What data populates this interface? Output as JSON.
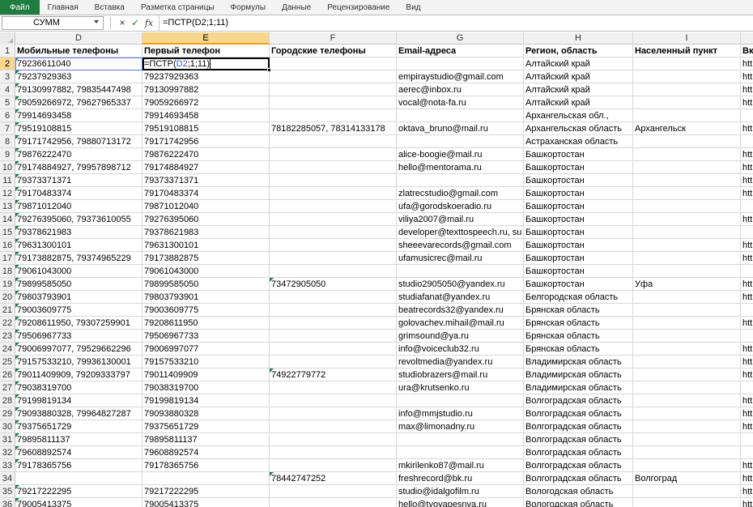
{
  "ribbon": {
    "tabs": [
      "Файл",
      "Главная",
      "Вставка",
      "Разметка страницы",
      "Формулы",
      "Данные",
      "Рецензирование",
      "Вид"
    ]
  },
  "formula_bar": {
    "name_box": "СУММ",
    "cancel_icon": "×",
    "enter_icon": "✓",
    "fx_label": "fx",
    "formula": "=ПСТР(D2;1;11)"
  },
  "columns": [
    "D",
    "E",
    "F",
    "G",
    "H",
    "I"
  ],
  "column_cut": "",
  "active_cell": {
    "row": 2,
    "column": "E",
    "prefix": "=ПСТР(",
    "ref": "D2",
    "suffix": ";1;11)"
  },
  "colors": {
    "accent": "#1f7d3f",
    "active_header": "#f9d68f",
    "reference_blue": "#3a5fcd"
  },
  "rows": [
    {
      "n": "1",
      "D": "Мобильные телефоны",
      "E": "Первый телефон",
      "F": "Городские телефоны",
      "G": "Email-адреса",
      "H": "Регион, область",
      "I": "Населенный пункт",
      "J": "Вк",
      "bold": true
    },
    {
      "n": "2",
      "D": "79236611040",
      "E": "",
      "F": "",
      "G": "",
      "H": "Алтайский край",
      "I": "",
      "J": "htt",
      "triD": true
    },
    {
      "n": "3",
      "D": "79237929363",
      "E": "79237929363",
      "F": "",
      "G": "empiraystudio@gmail.com",
      "H": "Алтайский край",
      "I": "",
      "J": "htt",
      "triD": true
    },
    {
      "n": "4",
      "D": "79130997882, 79835447498",
      "E": "79130997882",
      "F": "",
      "G": "aerec@inbox.ru",
      "H": "Алтайский край",
      "I": "",
      "J": "htt",
      "triD": true
    },
    {
      "n": "5",
      "D": "79059266972, 79627965337",
      "E": "79059266972",
      "F": "",
      "G": "vocal@nota-fa.ru",
      "H": "Алтайский край",
      "I": "",
      "J": "htt",
      "triD": true
    },
    {
      "n": "6",
      "D": "79914693458",
      "E": "79914693458",
      "F": "",
      "G": "",
      "H": "Архангельская обл.,",
      "I": "",
      "J": "",
      "triD": true
    },
    {
      "n": "7",
      "D": "79519108815",
      "E": "79519108815",
      "F": "78182285057, 78314133178",
      "G": "oktava_bruno@mail.ru",
      "H": "Архангельская область",
      "I": "Архангельск",
      "J": "htt",
      "triD": true
    },
    {
      "n": "8",
      "D": "79171742956, 79880713172",
      "E": "79171742956",
      "F": "",
      "G": "",
      "H": "Астраханская область",
      "I": "",
      "J": "",
      "triD": true
    },
    {
      "n": "9",
      "D": "79876222470",
      "E": "79876222470",
      "F": "",
      "G": "alice-boogie@mail.ru",
      "H": "Башкортостан",
      "I": "",
      "J": "htt",
      "triD": true
    },
    {
      "n": "10",
      "D": "79174884927, 79957898712",
      "E": "79174884927",
      "F": "",
      "G": "hello@mentorama.ru",
      "H": "Башкортостан",
      "I": "",
      "J": "htt",
      "triD": true
    },
    {
      "n": "11",
      "D": "79373371371",
      "E": "79373371371",
      "F": "",
      "G": "",
      "H": "Башкортостан",
      "I": "",
      "J": "htt",
      "triD": true
    },
    {
      "n": "12",
      "D": "79170483374",
      "E": "79170483374",
      "F": "",
      "G": "zlatrecstudio@gmail.com",
      "H": "Башкортостан",
      "I": "",
      "J": "htt",
      "triD": true
    },
    {
      "n": "13",
      "D": "79871012040",
      "E": "79871012040",
      "F": "",
      "G": "ufa@gorodskoeradio.ru",
      "H": "Башкортостан",
      "I": "",
      "J": "",
      "triD": true
    },
    {
      "n": "14",
      "D": "79276395060, 79373610055",
      "E": "79276395060",
      "F": "",
      "G": "viliya2007@mail.ru",
      "H": "Башкортостан",
      "I": "",
      "J": "htt",
      "triD": true
    },
    {
      "n": "15",
      "D": "79378621983",
      "E": "79378621983",
      "F": "",
      "G": "developer@texttospeech.ru, su",
      "H": "Башкортостан",
      "I": "",
      "J": "",
      "triD": true
    },
    {
      "n": "16",
      "D": "79631300101",
      "E": "79631300101",
      "F": "",
      "G": "sheeevarecords@gmail.com",
      "H": "Башкортостан",
      "I": "",
      "J": "htt",
      "triD": true
    },
    {
      "n": "17",
      "D": "79173882875, 79374965229",
      "E": "79173882875",
      "F": "",
      "G": "ufamusicrec@mail.ru",
      "H": "Башкортостан",
      "I": "",
      "J": "htt",
      "triD": true
    },
    {
      "n": "18",
      "D": "79061043000",
      "E": "79061043000",
      "F": "",
      "G": "",
      "H": "Башкортостан",
      "I": "",
      "J": "",
      "triD": true
    },
    {
      "n": "19",
      "D": "79899585050",
      "E": "79899585050",
      "F": "73472905050",
      "G": "studio2905050@yandex.ru",
      "H": "Башкортостан",
      "I": "Уфа",
      "J": "htt",
      "triD": true,
      "triF": true
    },
    {
      "n": "20",
      "D": "79803793901",
      "E": "79803793901",
      "F": "",
      "G": "studiafanat@yandex.ru",
      "H": "Белгородская область",
      "I": "",
      "J": "htt",
      "triD": true
    },
    {
      "n": "21",
      "D": "79003609775",
      "E": "79003609775",
      "F": "",
      "G": "beatrecords32@yandex.ru",
      "H": "Брянская область",
      "I": "",
      "J": "",
      "triD": true
    },
    {
      "n": "22",
      "D": "79208611950, 79307259901",
      "E": "79208611950",
      "F": "",
      "G": "golovachev.mihail@mail.ru",
      "H": "Брянская область",
      "I": "",
      "J": "htt",
      "triD": true
    },
    {
      "n": "23",
      "D": "79506967733",
      "E": "79506967733",
      "F": "",
      "G": "grimsound@ya.ru",
      "H": "Брянская область",
      "I": "",
      "J": "",
      "triD": true
    },
    {
      "n": "24",
      "D": "79006997077, 79529662296",
      "E": "79006997077",
      "F": "",
      "G": "info@voiceclub32.ru",
      "H": "Брянская область",
      "I": "",
      "J": "htt",
      "triD": true
    },
    {
      "n": "25",
      "D": "79157533210, 79936130001",
      "E": "79157533210",
      "F": "",
      "G": "revoltmedia@yandex.ru",
      "H": "Владимирская область",
      "I": "",
      "J": "htt",
      "triD": true
    },
    {
      "n": "26",
      "D": "79011409909, 79209333797",
      "E": "79011409909",
      "F": "74922779772",
      "G": "studiobrazers@mail.ru",
      "H": "Владимирская область",
      "I": "",
      "J": "htt",
      "triD": true,
      "triF": true
    },
    {
      "n": "27",
      "D": "79038319700",
      "E": "79038319700",
      "F": "",
      "G": "ura@krutsenko.ru",
      "H": "Владимирская область",
      "I": "",
      "J": "",
      "triD": true
    },
    {
      "n": "28",
      "D": "79199819134",
      "E": "79199819134",
      "F": "",
      "G": "",
      "H": "Волгоградская область",
      "I": "",
      "J": "htt",
      "triD": true
    },
    {
      "n": "29",
      "D": "79093880328, 79964827287",
      "E": "79093880328",
      "F": "",
      "G": "info@mmjstudio.ru",
      "H": "Волгоградская область",
      "I": "",
      "J": "htt",
      "triD": true
    },
    {
      "n": "30",
      "D": "79375651729",
      "E": "79375651729",
      "F": "",
      "G": "max@limonadny.ru",
      "H": "Волгоградская область",
      "I": "",
      "J": "htt",
      "triD": true
    },
    {
      "n": "31",
      "D": "79895811137",
      "E": "79895811137",
      "F": "",
      "G": "",
      "H": "Волгоградская область",
      "I": "",
      "J": "",
      "triD": true
    },
    {
      "n": "32",
      "D": "79608892574",
      "E": "79608892574",
      "F": "",
      "G": "",
      "H": "Волгоградская область",
      "I": "",
      "J": "",
      "triD": true
    },
    {
      "n": "33",
      "D": "79178365756",
      "E": "79178365756",
      "F": "",
      "G": "mkirilenko87@mail.ru",
      "H": "Волгоградская область",
      "I": "",
      "J": "htt",
      "triD": true
    },
    {
      "n": "34",
      "D": "",
      "E": "",
      "F": "78442747252",
      "G": "freshrecord@bk.ru",
      "H": "Волгоградская область",
      "I": "Волгоград",
      "J": "htt",
      "triF": true
    },
    {
      "n": "35",
      "D": "79217222295",
      "E": "79217222295",
      "F": "",
      "G": "studio@idalgofilm.ru",
      "H": "Вологодская область",
      "I": "",
      "J": "htt",
      "triD": true
    },
    {
      "n": "36",
      "D": "79005413375",
      "E": "79005413375",
      "F": "",
      "G": "hello@tvoyapesnya.ru",
      "H": "Вологодская область",
      "I": "",
      "J": "htt",
      "triD": true
    }
  ]
}
